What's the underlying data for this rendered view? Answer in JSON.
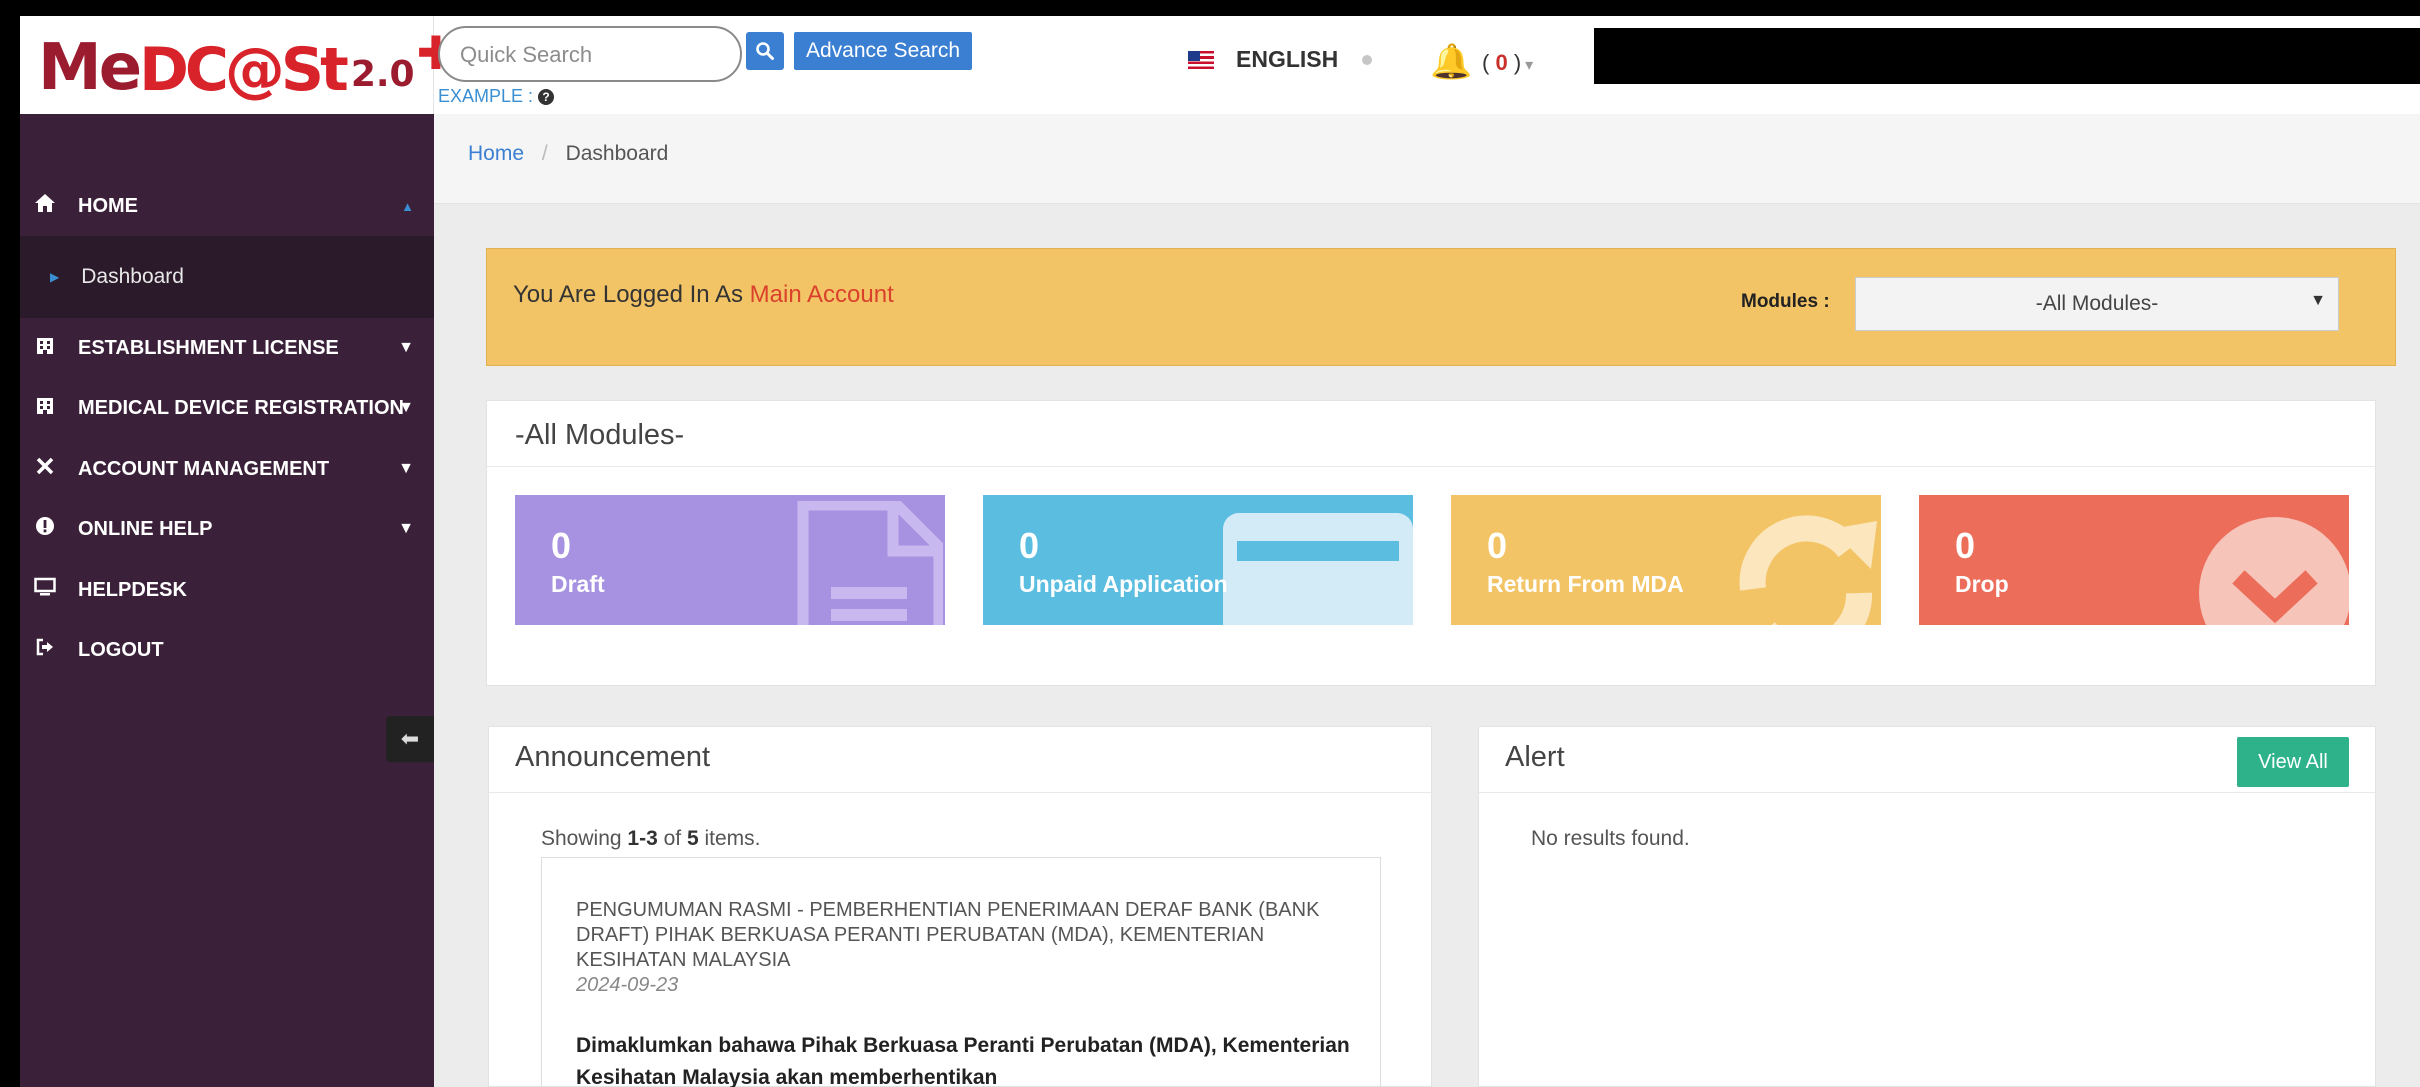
{
  "header": {
    "logo": "MeDC@St 2.0+",
    "search_placeholder": "Quick Search",
    "search_icon": "search-icon",
    "advance_search_label": "Advance Search",
    "example_label": "EXAMPLE :",
    "language": "ENGLISH",
    "notification_count": "0"
  },
  "sidebar": {
    "items": [
      {
        "label": "HOME",
        "icon": "home-icon"
      },
      {
        "label": "ESTABLISHMENT LICENSE",
        "icon": "building-icon"
      },
      {
        "label": "MEDICAL DEVICE REGISTRATION",
        "icon": "building-icon"
      },
      {
        "label": "ACCOUNT MANAGEMENT",
        "icon": "tools-icon"
      },
      {
        "label": "ONLINE HELP",
        "icon": "exclamation-icon"
      },
      {
        "label": "HELPDESK",
        "icon": "monitor-icon"
      },
      {
        "label": "LOGOUT",
        "icon": "sign-out-icon"
      }
    ],
    "subitem_dashboard": "Dashboard"
  },
  "breadcrumb": {
    "home": "Home",
    "separator": "/",
    "current": "Dashboard"
  },
  "login_banner": {
    "prefix": "You Are Logged In As",
    "account": "Main Account",
    "modules_label": "Modules :",
    "modules_selected": "-All Modules-"
  },
  "modules_panel": {
    "title": "-All Modules-",
    "tiles": [
      {
        "count": "0",
        "label": "Draft",
        "color": "#a692e0",
        "icon": "document-icon"
      },
      {
        "count": "0",
        "label": "Unpaid Application",
        "color": "#5bbde0",
        "icon": "credit-card-icon"
      },
      {
        "count": "0",
        "label": "Return From MDA",
        "color": "#f3c466",
        "icon": "refresh-icon"
      },
      {
        "count": "0",
        "label": "Drop",
        "color": "#ec6d5a",
        "icon": "chevron-circle-icon"
      }
    ]
  },
  "announcement": {
    "title": "Announcement",
    "summary_prefix": "Showing",
    "summary_range": "1-3",
    "summary_of": "of",
    "summary_total": "5",
    "summary_suffix": "items.",
    "item_title": "PENGUMUMAN RASMI - PEMBERHENTIAN PENERIMAAN DERAF BANK (BANK DRAFT) PIHAK BERKUASA PERANTI PERUBATAN (MDA), KEMENTERIAN KESIHATAN MALAYSIA",
    "item_date": "2024-09-23",
    "item_body": "Dimaklumkan bahawa Pihak Berkuasa Peranti Perubatan (MDA), Kementerian Kesihatan Malaysia akan memberhentikan"
  },
  "alert": {
    "title": "Alert",
    "view_all_label": "View All",
    "empty_text": "No results found."
  }
}
